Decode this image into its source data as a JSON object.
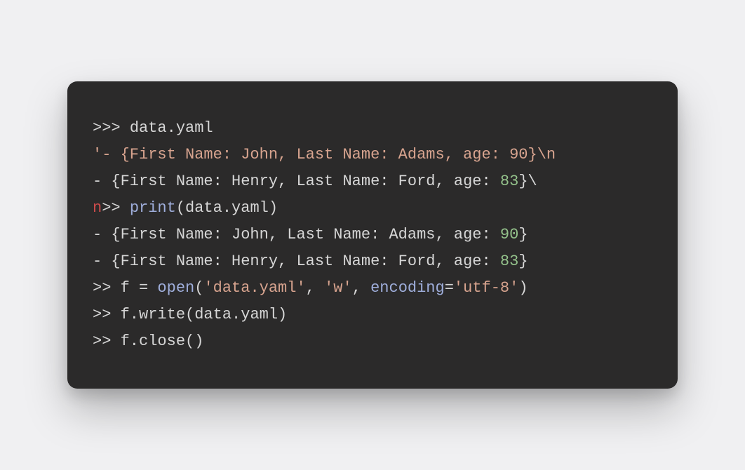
{
  "code": {
    "l1": {
      "prompt": ">>> ",
      "rest": "data.yaml"
    },
    "l2": {
      "str": "'- {First Name: John, Last Name: Adams, age: 90}\\n"
    },
    "l3": {
      "a": "- {First Name: Henry, Last Name: Ford, age: ",
      "b": "83",
      "c": "}\\"
    },
    "l4": {
      "caret": "n",
      "prompt": ">> ",
      "fn": "print",
      "rest": "(data.yaml)"
    },
    "l5": {
      "a": "- {First Name: John, Last Name: Adams, age: ",
      "b": "90",
      "c": "}"
    },
    "l6": {
      "a": "- {First Name: Henry, Last Name: Ford, age: ",
      "b": "83",
      "c": "}"
    },
    "l7": {
      "prompt": ">> ",
      "a": "f = ",
      "fn": "open",
      "b": "(",
      "s1": "'data.yaml'",
      "c": ", ",
      "s2": "'w'",
      "d": ", ",
      "kw": "encoding",
      "e": "=",
      "s3": "'utf-8'",
      "f": ")"
    },
    "l8": {
      "prompt": ">> ",
      "rest": "f.write(data.yaml)"
    },
    "l9": {
      "prompt": ">> ",
      "rest": "f.close()"
    }
  }
}
